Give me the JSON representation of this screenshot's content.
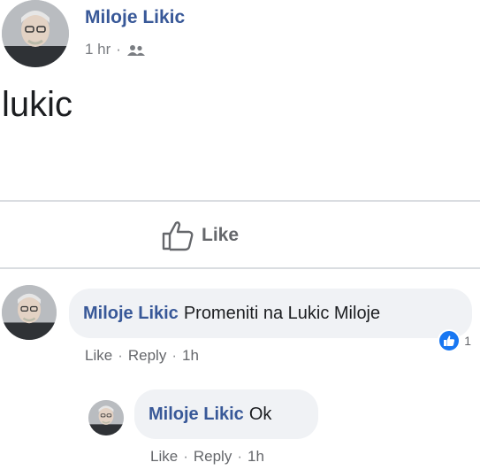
{
  "post": {
    "author": "Miloje Likic",
    "time": "1 hr",
    "separator": "·",
    "audience_icon": "friends-icon",
    "text": "lukic"
  },
  "actions": {
    "like_label": "Like"
  },
  "comments": [
    {
      "author": "Miloje Likic",
      "text": "Promeniti na Lukic Miloje",
      "reaction_count": "1",
      "like": "Like",
      "reply": "Reply",
      "time": "1h",
      "dot": "·"
    },
    {
      "author": "Miloje Likic",
      "text": "Ok",
      "like": "Like",
      "reply": "Reply",
      "time": "1h",
      "dot": "·"
    }
  ],
  "colors": {
    "name_blue": "#385898",
    "meta_gray": "#65676b",
    "bubble_bg": "#f0f2f5",
    "like_blue": "#1877f2"
  }
}
